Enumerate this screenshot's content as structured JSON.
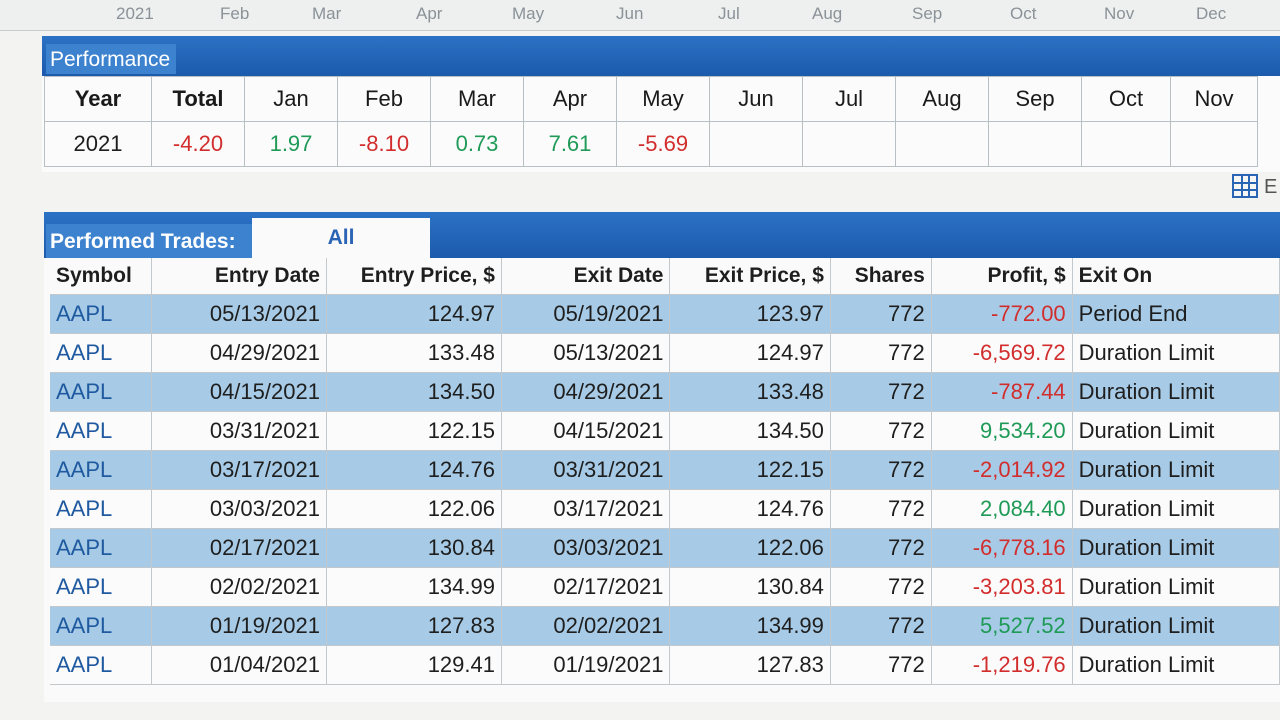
{
  "axis": {
    "year": "2021",
    "months": [
      "Feb",
      "Mar",
      "Apr",
      "May",
      "Jun",
      "Jul",
      "Aug",
      "Sep",
      "Oct",
      "Nov",
      "Dec"
    ]
  },
  "performance": {
    "title": "Performance",
    "headers": [
      "Year",
      "Total",
      "Jan",
      "Feb",
      "Mar",
      "Apr",
      "May",
      "Jun",
      "Jul",
      "Aug",
      "Sep",
      "Oct",
      "Nov"
    ],
    "row": [
      "2021",
      "-4.20",
      "1.97",
      "-8.10",
      "0.73",
      "7.61",
      "-5.69",
      "",
      "",
      "",
      "",
      "",
      ""
    ]
  },
  "export_letter": "E",
  "trades": {
    "title": "Performed Trades:",
    "filter": "All",
    "columns": [
      "Symbol",
      "Entry Date",
      "Entry Price, $",
      "Exit Date",
      "Exit Price, $",
      "Shares",
      "Profit, $",
      "Exit On"
    ],
    "rows": [
      [
        "AAPL",
        "05/13/2021",
        "124.97",
        "05/19/2021",
        "123.97",
        "772",
        "-772.00",
        "Period End"
      ],
      [
        "AAPL",
        "04/29/2021",
        "133.48",
        "05/13/2021",
        "124.97",
        "772",
        "-6,569.72",
        "Duration Limit"
      ],
      [
        "AAPL",
        "04/15/2021",
        "134.50",
        "04/29/2021",
        "133.48",
        "772",
        "-787.44",
        "Duration Limit"
      ],
      [
        "AAPL",
        "03/31/2021",
        "122.15",
        "04/15/2021",
        "134.50",
        "772",
        "9,534.20",
        "Duration Limit"
      ],
      [
        "AAPL",
        "03/17/2021",
        "124.76",
        "03/31/2021",
        "122.15",
        "772",
        "-2,014.92",
        "Duration Limit"
      ],
      [
        "AAPL",
        "03/03/2021",
        "122.06",
        "03/17/2021",
        "124.76",
        "772",
        "2,084.40",
        "Duration Limit"
      ],
      [
        "AAPL",
        "02/17/2021",
        "130.84",
        "03/03/2021",
        "122.06",
        "772",
        "-6,778.16",
        "Duration Limit"
      ],
      [
        "AAPL",
        "02/02/2021",
        "134.99",
        "02/17/2021",
        "130.84",
        "772",
        "-3,203.81",
        "Duration Limit"
      ],
      [
        "AAPL",
        "01/19/2021",
        "127.83",
        "02/02/2021",
        "134.99",
        "772",
        "5,527.52",
        "Duration Limit"
      ],
      [
        "AAPL",
        "01/04/2021",
        "129.41",
        "01/19/2021",
        "127.83",
        "772",
        "-1,219.76",
        "Duration Limit"
      ]
    ]
  },
  "colors": {
    "header_blue": "#1c5aad",
    "row_blue": "#a7cbe6",
    "negative": "#d22d2d",
    "positive": "#1f9a57"
  }
}
